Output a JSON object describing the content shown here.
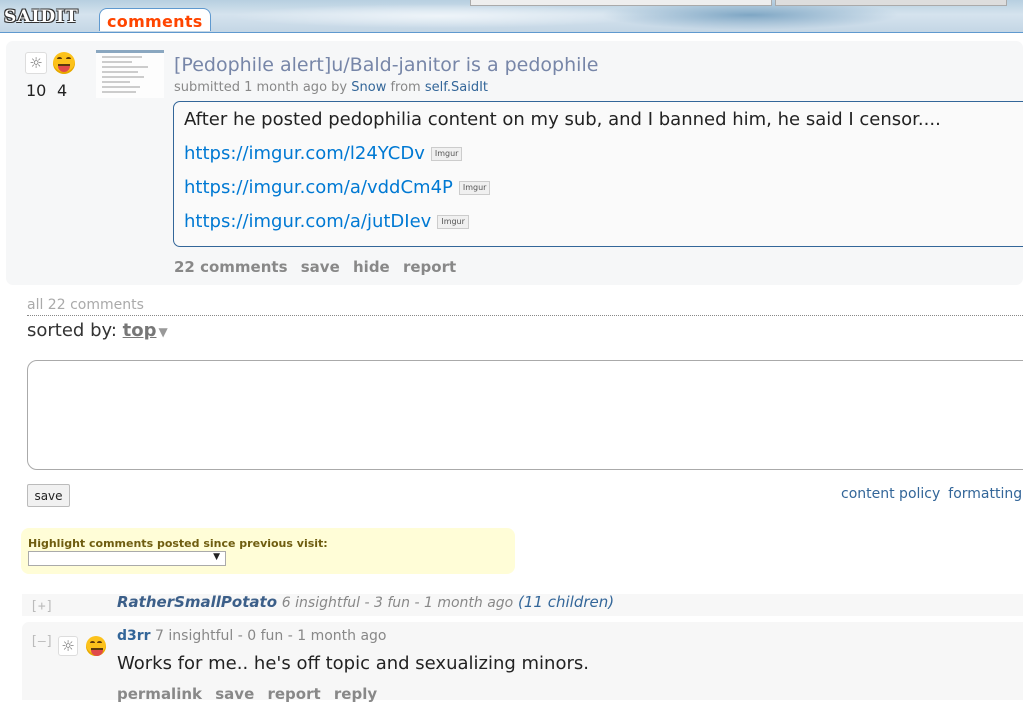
{
  "header": {
    "logo": "SAIDIT",
    "active_tab": "comments"
  },
  "post": {
    "insightful_count": "10",
    "fun_count": "4",
    "title": "[Pedophile alert]u/Bald-janitor is a pedophile",
    "tagline_prefix": "submitted 1 month ago by",
    "author": "Snow",
    "from": "from",
    "sub": "self.SaidIt",
    "body_text": "After he posted pedophilia content on my sub, and I banned him, he said I censor....",
    "links": [
      {
        "url": "https://imgur.com/l24YCDv",
        "domain": "Imgur"
      },
      {
        "url": "https://imgur.com/a/vddCm4P",
        "domain": "Imgur"
      },
      {
        "url": "https://imgur.com/a/jutDIev",
        "domain": "Imgur"
      }
    ],
    "buttons": {
      "comments": "22 comments",
      "save": "save",
      "hide": "hide",
      "report": "report"
    }
  },
  "comments_section": {
    "all_comments": "all 22 comments",
    "sorted_by_label": "sorted by:",
    "sorted_by_value": "top",
    "save_button": "save",
    "content_policy": "content policy",
    "formatting": "formatting help",
    "highlight_label": "Highlight comments posted since previous visit:",
    "highlight_selected": ""
  },
  "comments": [
    {
      "toggle": "[+]",
      "author": "RatherSmallPotato",
      "meta": "6 insightful - 3 fun - 1 month ago",
      "children": "(11 children)"
    },
    {
      "toggle": "[–]",
      "author": "d3rr",
      "meta": "7 insightful - 0 fun - 1 month ago",
      "body": "Works for me.. he's off topic and sexualizing minors.",
      "buttons": {
        "permalink": "permalink",
        "save": "save",
        "report": "report",
        "reply": "reply"
      }
    }
  ],
  "colors": {
    "header_border": "#5f99cf",
    "tab_text": "#ff4500",
    "link": "#0079d3",
    "author": "#336699"
  },
  "icons": {
    "insightful": "lightbulb-icon",
    "fun": "laughing-face-icon"
  }
}
